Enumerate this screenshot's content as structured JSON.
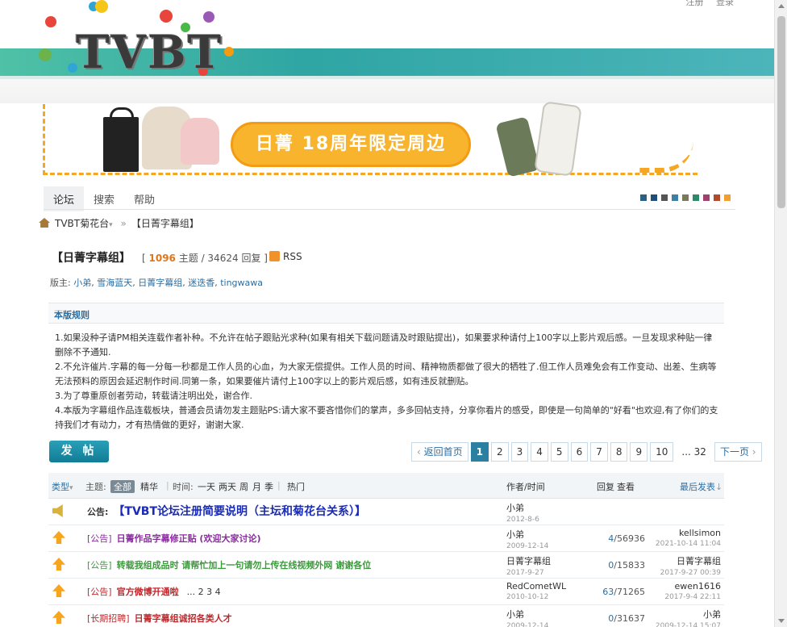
{
  "header": {
    "top_links": [
      "注册",
      "登录"
    ],
    "logo_text": "TVBT"
  },
  "banner": {
    "text": "日菁 18周年限定周边"
  },
  "nav": {
    "tabs": [
      "论坛",
      "搜索",
      "帮助"
    ],
    "active_tab": "论坛",
    "swatch_colors": [
      "#2a5f86",
      "#1f4f78",
      "#555555",
      "#3d7fa6",
      "#7a7a5a",
      "#2c8a6a",
      "#a0406e",
      "#b04a2a",
      "#f0a030"
    ]
  },
  "breadcrumb": {
    "home": "TVBT菊花台",
    "current": "【日菁字幕组】"
  },
  "forum": {
    "title": "【日菁字幕组】",
    "topics_count": "1096",
    "topics_label": "主题",
    "replies_count": "34624",
    "replies_label": "回复",
    "rss_label": "RSS",
    "moderators_label": "版主:",
    "moderators": [
      "小弟",
      "雪海蓝天",
      "日菁字幕组",
      "迷迭香",
      "tingwawa"
    ]
  },
  "rules": {
    "title": "本版规则",
    "collapse": "—",
    "lines": [
      "1.如果没种子请PM相关连载作者补种。不允许在帖子跟贴光求种(如果有相关下载问题请及时跟贴提出)，如果要求种请付上100字以上影片观后感。一旦发现求种贴一律删除不予通知.",
      "2.不允许催片.字幕的每一分每一秒都是工作人员的心血，为大家无偿提供。工作人员的时间、精神物质都做了很大的牺牲了.但工作人员难免会有工作变动、出差、生病等无法预料的原因会延迟制作时间.同第一条，如果要催片请付上100字以上的影片观后感，如有违反就删贴。",
      "3.为了尊重原创者劳动，转载请注明出处，谢合作.",
      "4.本版为字幕组作品连载板块，普通会员请勿发主题贴PS:请大家不要吝惜你们的掌声，多多回帖支持，分享你看片的感受，即使是一句简单的\"好看\"也欢迎,有了你们的支持我们才有动力，才有热情做的更好，谢谢大家."
    ]
  },
  "toolbar": {
    "post_label": "发 帖"
  },
  "pager": {
    "prev": "返回首页",
    "pages": [
      "1",
      "2",
      "3",
      "4",
      "5",
      "6",
      "7",
      "8",
      "9",
      "10"
    ],
    "current": "1",
    "ellipsis_last": "... 32",
    "next": "下一页"
  },
  "list_header": {
    "type": "类型",
    "topic_label": "主题:",
    "all": "全部",
    "digest": "精华",
    "time_label": "时间:",
    "time_options": [
      "一天",
      "两天",
      "周",
      "月",
      "季"
    ],
    "hot": "热门",
    "author_time": "作者/时间",
    "reply": "回复",
    "view": "查看",
    "last_post": "最后发表"
  },
  "threads": [
    {
      "icon": "speaker-icon",
      "tag": "公告:",
      "title": "【TVBT论坛注册简要说明（主坛和菊花台关系）】",
      "title_color": "#1a2bb5",
      "author": "小弟",
      "date": "2012-8-6",
      "replies": "",
      "views": "",
      "last_user": "",
      "last_time": ""
    },
    {
      "icon": "up-arrow-icon",
      "tag": "[公告]",
      "title": "日菁作品字幕修正贴 (欢迎大家讨论)",
      "title_color": "#8a2a9e",
      "author": "小弟",
      "date": "2009-12-14",
      "replies": "4",
      "views": "56936",
      "last_user": "kellsimon",
      "last_time": "2021-10-14 11:04"
    },
    {
      "icon": "up-arrow-icon",
      "tag": "[公告]",
      "title": "转载我组成品时 请帮忙加上一句请勿上传在线视频外网 谢谢各位",
      "title_color": "#3a9a3a",
      "author": "日菁字幕组",
      "date": "2017-9-27",
      "replies": "0",
      "views": "15833",
      "last_user": "日菁字幕组",
      "last_time": "2017-9-27 00:39"
    },
    {
      "icon": "up-arrow-icon",
      "tag": "[公告]",
      "title": "官方微博开通啦",
      "title_color": "#c0282c",
      "pages": "... 2  3  4",
      "author": "RedCometWL",
      "date": "2010-10-12",
      "replies": "63",
      "views": "71265",
      "last_user": "ewen1616",
      "last_time": "2017-9-4 22:11"
    },
    {
      "icon": "up-arrow-icon",
      "tag": "[长期招聘]",
      "title": "日菁字幕组诚招各类人才",
      "title_color": "#c0282c",
      "author": "小弟",
      "date": "2009-12-14",
      "replies": "0",
      "views": "31637",
      "last_user": "小弟",
      "last_time": "2009-12-14 15:07"
    }
  ]
}
